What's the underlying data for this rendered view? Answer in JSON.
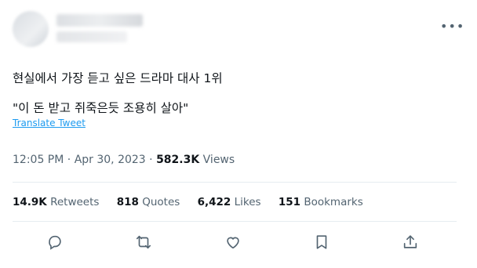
{
  "tweet": {
    "text_line1": "현실에서 가장 듣고 싶은 드라마 대사 1위",
    "text_line2": "\"이 돈 받고 쥐죽은듯 조용히 살아\"",
    "translate_label": "Translate Tweet",
    "time": "12:05 PM",
    "separator": "·",
    "date": "Apr 30, 2023",
    "views_count": "582.3K",
    "views_label": "Views"
  },
  "stats": {
    "retweets_count": "14.9K",
    "retweets_label": "Retweets",
    "quotes_count": "818",
    "quotes_label": "Quotes",
    "likes_count": "6,422",
    "likes_label": "Likes",
    "bookmarks_count": "151",
    "bookmarks_label": "Bookmarks"
  },
  "icons": {
    "more": "more-icon",
    "reply": "reply-icon",
    "retweet": "retweet-icon",
    "like": "like-icon",
    "bookmark": "bookmark-icon",
    "share": "share-icon"
  },
  "colors": {
    "text": "#0f1419",
    "secondary": "#536471",
    "link": "#1d9bf0",
    "divider": "#e6ecf0"
  }
}
